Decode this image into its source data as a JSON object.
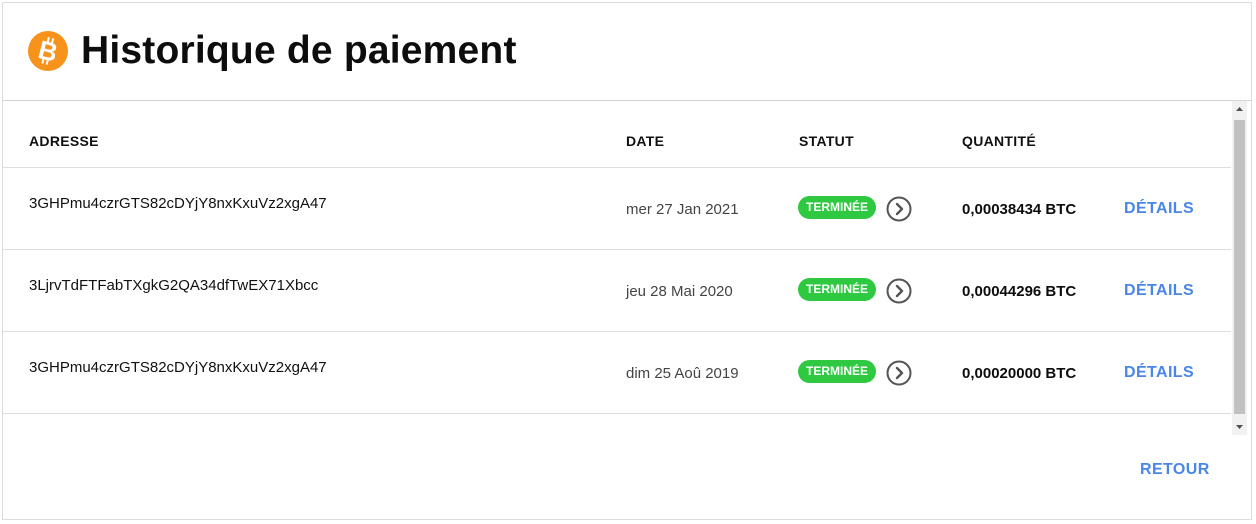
{
  "header": {
    "title": "Historique de paiement",
    "logo_icon": "bitcoin-icon",
    "logo_color": "#f7931a"
  },
  "table": {
    "columns": {
      "address": "ADRESSE",
      "date": "DATE",
      "status": "STATUT",
      "quantity": "QUANTITÉ"
    },
    "rows": [
      {
        "address": "3GHPmu4czrGTS82cDYjY8nxKxuVz2xgA47",
        "date": "mer 27 Jan 2021",
        "status": "TERMINÉE",
        "quantity": "0,00038434 BTC",
        "details_label": "DÉTAILS"
      },
      {
        "address": "3LjrvTdFTFabTXgkG2QA34dfTwEX71Xbcc",
        "date": "jeu 28 Mai 2020",
        "status": "TERMINÉE",
        "quantity": "0,00044296 BTC",
        "details_label": "DÉTAILS"
      },
      {
        "address": "3GHPmu4czrGTS82cDYjY8nxKxuVz2xgA47",
        "date": "dim 25 Aoû 2019",
        "status": "TERMINÉE",
        "quantity": "0,00020000 BTC",
        "details_label": "DÉTAILS"
      }
    ]
  },
  "footer": {
    "back_label": "RETOUR"
  },
  "colors": {
    "accent": "#4a86e8",
    "status_done": "#2ec941"
  }
}
